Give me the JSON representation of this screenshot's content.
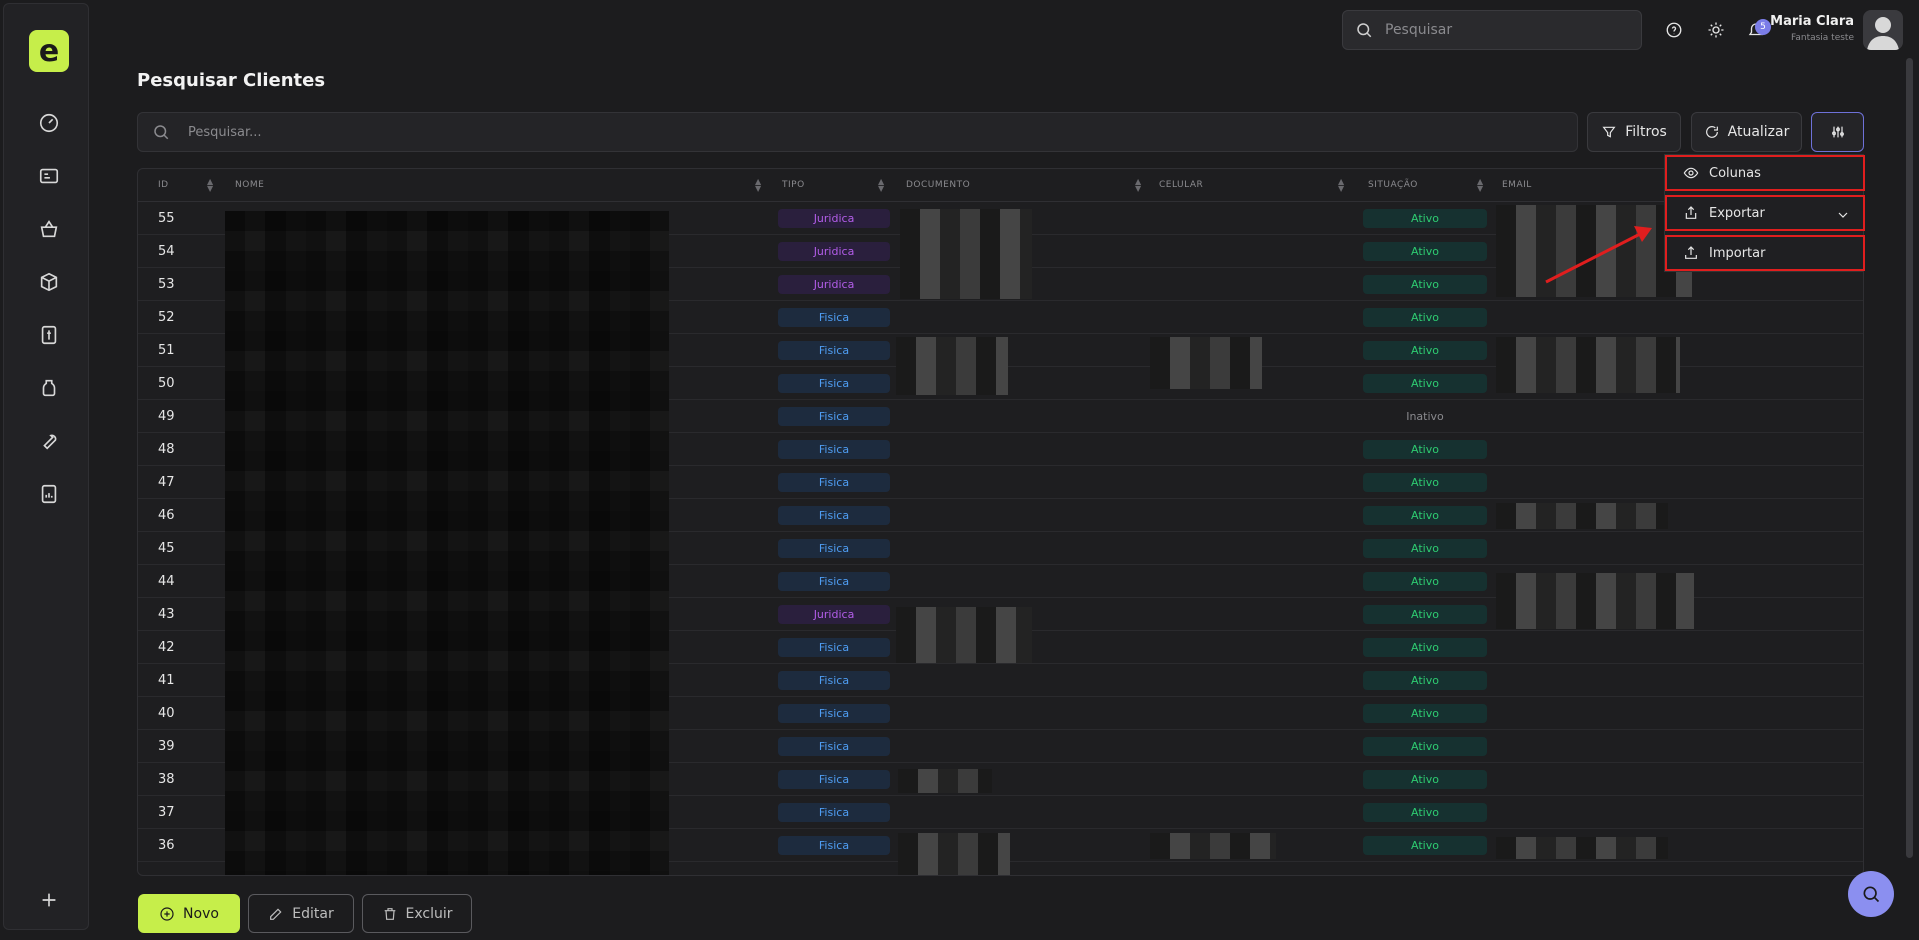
{
  "app": {
    "logo_letter": "e"
  },
  "sidebar": {
    "items": [
      {
        "icon": "dashboard-icon"
      },
      {
        "icon": "id-card-icon"
      },
      {
        "icon": "basket-icon"
      },
      {
        "icon": "box-icon"
      },
      {
        "icon": "money-document-icon"
      },
      {
        "icon": "jar-icon"
      },
      {
        "icon": "wrench-icon"
      },
      {
        "icon": "report-icon"
      }
    ],
    "add_icon": "plus-icon"
  },
  "topbar": {
    "search_placeholder": "Pesquisar",
    "notifications_count": "5",
    "user_name": "Maria Clara",
    "user_company": "Fantasia teste"
  },
  "page": {
    "title": "Pesquisar Clientes",
    "search_placeholder": "Pesquisar...",
    "filters_label": "Filtros",
    "refresh_label": "Atualizar"
  },
  "table": {
    "columns": [
      "ID",
      "NOME",
      "TIPO",
      "DOCUMENTO",
      "CELULAR",
      "SITUAÇÃO",
      "EMAIL"
    ],
    "rows": [
      {
        "id": "55",
        "tipo": "Juridica",
        "situacao": "Ativo"
      },
      {
        "id": "54",
        "tipo": "Juridica",
        "situacao": "Ativo"
      },
      {
        "id": "53",
        "tipo": "Juridica",
        "situacao": "Ativo"
      },
      {
        "id": "52",
        "tipo": "Fisica",
        "situacao": "Ativo"
      },
      {
        "id": "51",
        "tipo": "Fisica",
        "situacao": "Ativo"
      },
      {
        "id": "50",
        "tipo": "Fisica",
        "situacao": "Ativo"
      },
      {
        "id": "49",
        "tipo": "Fisica",
        "situacao": "Inativo"
      },
      {
        "id": "48",
        "tipo": "Fisica",
        "situacao": "Ativo"
      },
      {
        "id": "47",
        "tipo": "Fisica",
        "situacao": "Ativo"
      },
      {
        "id": "46",
        "tipo": "Fisica",
        "situacao": "Ativo"
      },
      {
        "id": "45",
        "tipo": "Fisica",
        "situacao": "Ativo"
      },
      {
        "id": "44",
        "tipo": "Fisica",
        "situacao": "Ativo"
      },
      {
        "id": "43",
        "tipo": "Juridica",
        "situacao": "Ativo"
      },
      {
        "id": "42",
        "tipo": "Fisica",
        "situacao": "Ativo"
      },
      {
        "id": "41",
        "tipo": "Fisica",
        "situacao": "Ativo"
      },
      {
        "id": "40",
        "tipo": "Fisica",
        "situacao": "Ativo"
      },
      {
        "id": "39",
        "tipo": "Fisica",
        "situacao": "Ativo"
      },
      {
        "id": "38",
        "tipo": "Fisica",
        "situacao": "Ativo"
      },
      {
        "id": "37",
        "tipo": "Fisica",
        "situacao": "Ativo"
      },
      {
        "id": "36",
        "tipo": "Fisica",
        "situacao": "Ativo"
      }
    ]
  },
  "dropdown": {
    "columns_label": "Colunas",
    "export_label": "Exportar",
    "import_label": "Importar"
  },
  "footer": {
    "new_label": "Novo",
    "edit_label": "Editar",
    "delete_label": "Excluir"
  },
  "colors": {
    "accent": "#c6ee4a",
    "fab": "#8b8ff0",
    "ativo": "#2ecc71",
    "fisica": "#4f9df2",
    "juridica": "#b25de8",
    "highlight": "#e01e1e"
  }
}
